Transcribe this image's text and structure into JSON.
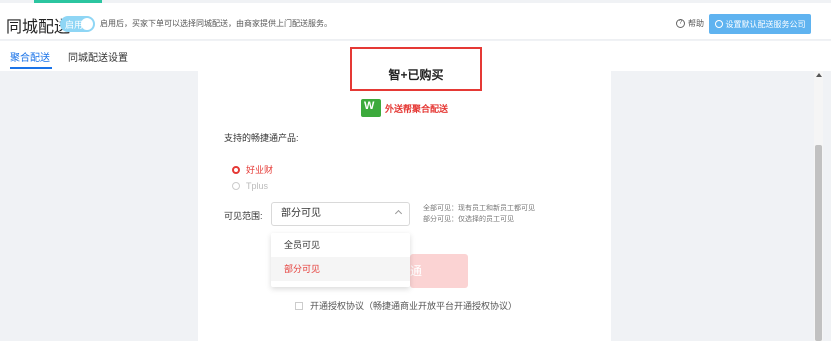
{
  "header": {
    "title": "同城配送",
    "toggle_label": "启用",
    "hint": "启用后，买家下单可以选择同城配送，由商家提供上门配送服务。",
    "help_label": "帮助",
    "default_company_button": "设置默认配送服务公司"
  },
  "tabs": [
    {
      "label": "聚合配送",
      "active": true
    },
    {
      "label": "同城配送设置",
      "active": false
    }
  ],
  "card": {
    "product_title": "智+已购买",
    "brand_name": "外送帮聚合配送",
    "supported_label": "支持的畅捷通产品:",
    "products": [
      {
        "label": "好业财",
        "checked": true
      },
      {
        "label": "Tplus",
        "checked": false
      }
    ],
    "visibility_label": "可见范围:",
    "visibility_value": "部分可见",
    "visibility_note_1": "全部可见：现有员工和新员工都可见",
    "visibility_note_2": "部分可见：仅选择的员工可见",
    "dropdown_options": [
      {
        "label": "全员可见",
        "selected": false
      },
      {
        "label": "部分可见",
        "selected": true
      }
    ],
    "open_button_visible": "通",
    "agreement_text": "开通授权协议（畅捷通商业开放平台开通授权协议）"
  },
  "colors": {
    "accent_blue": "#1a73e8",
    "accent_red": "#e53935",
    "teal": "#2bc5a0"
  }
}
